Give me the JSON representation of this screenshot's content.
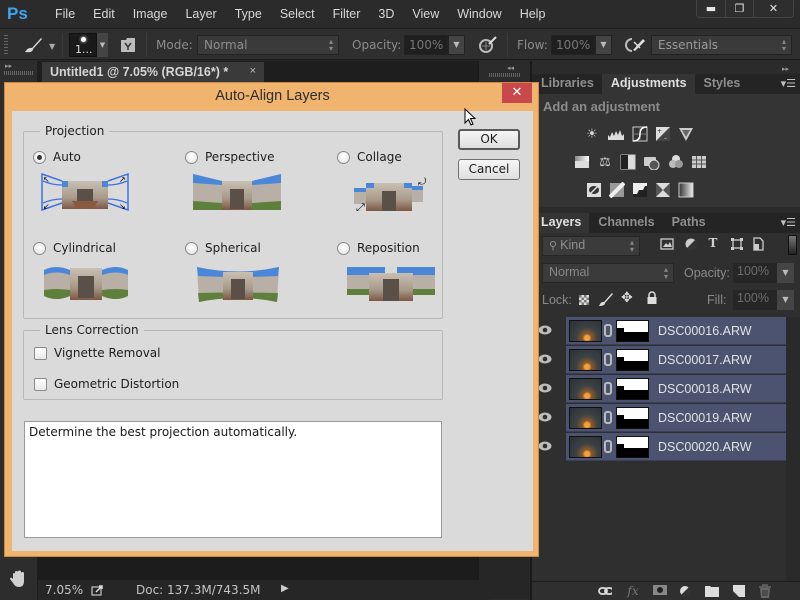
{
  "app": {
    "logo": "Ps",
    "menu": [
      "File",
      "Edit",
      "Image",
      "Layer",
      "Type",
      "Select",
      "Filter",
      "3D",
      "View",
      "Window",
      "Help"
    ],
    "window_controls": {
      "minimize": "▬",
      "restore": "❐",
      "close": "✕"
    }
  },
  "options_bar": {
    "brush_size": "1...",
    "mode_label": "Mode:",
    "mode_value": "Normal",
    "opacity_label": "Opacity:",
    "opacity_value": "100%",
    "flow_label": "Flow:",
    "flow_value": "100%",
    "workspace": "Essentials"
  },
  "document": {
    "tab_title": "Untitled1 @ 7.05% (RGB/16*) *",
    "tab_close": "×",
    "zoom": "7.05%",
    "doc_size": "Doc: 137.3M/743.5M"
  },
  "adjustments_panel": {
    "tabs": [
      "Libraries",
      "Adjustments",
      "Styles"
    ],
    "active_tab": "Adjustments",
    "title": "Add an adjustment",
    "rows": [
      [
        "brightness-contrast",
        "levels",
        "curves",
        "exposure",
        "vibrance"
      ],
      [
        "hue-saturation",
        "color-balance",
        "black-white",
        "photo-filter",
        "channel-mixer",
        "color-lookup"
      ],
      [
        "invert",
        "posterize",
        "threshold",
        "selective-color",
        "gradient-map"
      ]
    ]
  },
  "layers_panel": {
    "tabs": [
      "Layers",
      "Channels",
      "Paths"
    ],
    "active_tab": "Layers",
    "filter_kind": "Kind",
    "blend_mode": "Normal",
    "opacity_label": "Opacity:",
    "opacity_value": "100%",
    "lock_label": "Lock:",
    "fill_label": "Fill:",
    "fill_value": "100%",
    "layers": [
      {
        "name": "DSC00016.ARW",
        "visible": true,
        "selected": true
      },
      {
        "name": "DSC00017.ARW",
        "visible": true,
        "selected": true
      },
      {
        "name": "DSC00018.ARW",
        "visible": true,
        "selected": true
      },
      {
        "name": "DSC00019.ARW",
        "visible": true,
        "selected": true
      },
      {
        "name": "DSC00020.ARW",
        "visible": true,
        "selected": true
      }
    ],
    "footer_icons": [
      "link-layers",
      "fx",
      "add-mask",
      "new-adjustment",
      "new-group",
      "new-layer",
      "delete-layer"
    ]
  },
  "dialog": {
    "title": "Auto-Align Layers",
    "close": "✕",
    "ok_label": "OK",
    "cancel_label": "Cancel",
    "projection": {
      "group_label": "Projection",
      "selected": "Auto",
      "options": [
        "Auto",
        "Perspective",
        "Collage",
        "Cylindrical",
        "Spherical",
        "Reposition"
      ]
    },
    "lens_correction": {
      "group_label": "Lens Correction",
      "vignette_removal": {
        "label": "Vignette Removal",
        "checked": false
      },
      "geometric_distortion": {
        "label": "Geometric Distortion",
        "checked": false
      }
    },
    "description": "Determine the best projection automatically."
  },
  "colors": {
    "dialog_frame": "#f0b46e",
    "dialog_close": "#c8484b",
    "layer_selected": "#4b5370",
    "ps_blue": "#3ea6ee"
  }
}
